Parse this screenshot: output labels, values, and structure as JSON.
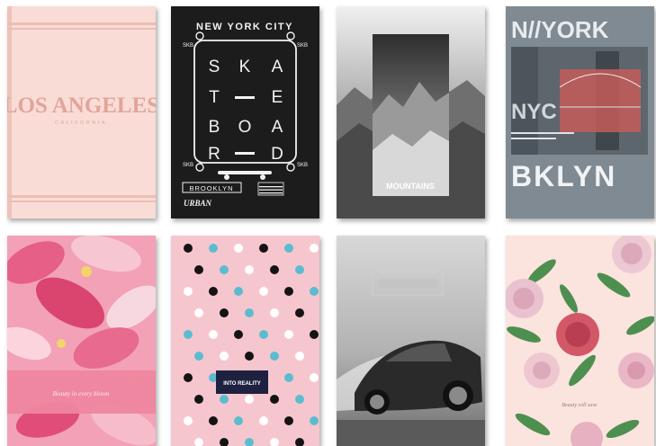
{
  "covers": [
    {
      "title": "LOS ANGELES",
      "subtitle": "CALIFORNIA",
      "colors": {
        "bg": "#f9dcd6",
        "accent": "#e8b3ab"
      }
    },
    {
      "top": "NEW YORK CITY",
      "letters": [
        "S",
        "K",
        "A",
        "T",
        "E",
        "B",
        "O",
        "A",
        "R",
        "D"
      ],
      "corner": "SKB",
      "brooklyn": "BROOKLYN",
      "urban": "URBAN",
      "colors": {
        "bg": "#1c1c1c",
        "fg": "#f2f2f2"
      }
    },
    {
      "title": "MOUNTAINS",
      "colors": {
        "bg": "#9a9a9a"
      }
    },
    {
      "line1": "N//YORK",
      "nyc": "NYC",
      "bottom": "BKLYN",
      "colors": {
        "bg": "#7f8a92",
        "red": "#c45b5b"
      }
    },
    {
      "script": "Beauty in every bloom",
      "colors": {
        "bg": "#f3a1b6",
        "band": "#ee86a0"
      }
    },
    {
      "label": "INTO REALITY",
      "colors": {
        "bg": "#f6c6cf",
        "black": "#141414",
        "teal": "#5cbccf",
        "navy": "#1e2140"
      }
    },
    {
      "colors": {
        "bg": "#b5b5b5"
      }
    },
    {
      "script": "Beauty will save",
      "colors": {
        "bg": "#fbe3de",
        "leaf": "#4d8f4f",
        "rose": "#d25868"
      }
    }
  ]
}
